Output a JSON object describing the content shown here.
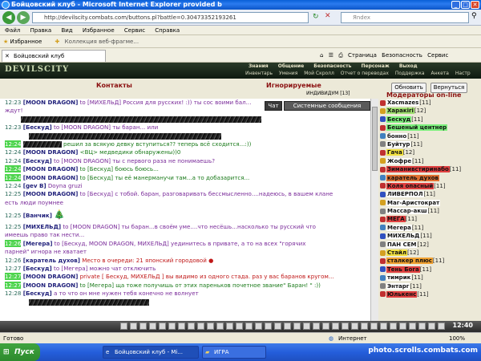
{
  "window": {
    "title": "Бойцовский клуб - Microsoft Internet Explorer provided b",
    "url": "http://devilscity.combats.com/buttons.pl?battle=0.30473352193261",
    "search_placeholder": "Яndex"
  },
  "menu": [
    "Файл",
    "Правка",
    "Вид",
    "Избранное",
    "Сервис",
    "Справка"
  ],
  "favorites": {
    "label": "Избранное",
    "link": "Коллекция веб-фрагме..."
  },
  "tab": {
    "label": "Бойцовский клуб"
  },
  "tools": [
    "Страница",
    "Безопасность",
    "Сервис"
  ],
  "game": {
    "logo": "DEVILSCITY",
    "topnav": [
      "Знания",
      "Общение",
      "Безопасность",
      "Персонаж",
      "Выход"
    ],
    "subnav": [
      "Инвентарь",
      "Умения",
      "Мой Скролл",
      "Отчет о переводах",
      "Поддержка",
      "Анкета",
      "Настр"
    ]
  },
  "panel": {
    "contacts": "Контакты",
    "ignored": "Игнорируемые",
    "moderators": "Модераторы on-line",
    "refresh": "Обновить",
    "back": "Вернуться",
    "individual": "ИНДИВИДУМ [13]"
  },
  "chattabs": {
    "chat": "Чат",
    "system": "Системные сообщения"
  },
  "chat": [
    {
      "time": "12:23",
      "nick": "[MOON DRAGON]",
      "text": " to [МИХЕЛЬД] Россия для русских! :)) ты сос воими бал..."
    },
    {
      "time": "",
      "nick": "",
      "text": "ждут!"
    },
    {
      "time": "12:23",
      "nick": "[Бескуд]",
      "text": " to [MOON DRAGON] ты баран... или"
    },
    {
      "time": "12:24",
      "nick": "",
      "text": " решил за всякую девку вступиться?? теперь всё сходится...:))"
    },
    {
      "time": "12:24",
      "nick": "[MOON DRAGON]",
      "text": " <ВЦ> медведики обнаружены))0"
    },
    {
      "time": "12:24",
      "nick": "[Бескуд]",
      "text": " to [MOON DRAGON] ты с первого раза не понимаешь?"
    },
    {
      "time": "12:24",
      "nick": "[MOON DRAGON]",
      "text": " to [Бескуд] боюсь боюсь..."
    },
    {
      "time": "12:24",
      "nick": "[MOON DRAGON]",
      "text": " to [Бескуд] ты её манерманучи там...а то добазарится..."
    },
    {
      "time": "12:24",
      "nick": "[gev B]",
      "text": " Doyna gruzi"
    },
    {
      "time": "12:25",
      "nick": "[MOON DRAGON]",
      "text": " to [Бескуд] с тобой. баран, разговаривать бессмысленно....надеюсь, в вашем клане"
    },
    {
      "time": "",
      "nick": "",
      "text": "есть люди поумнее"
    },
    {
      "time": "12:25",
      "nick": "[Ванчик]",
      "text": ""
    },
    {
      "time": "12:25",
      "nick": "[МИХЕЛЬД]",
      "text": " to [MOON DRAGON] ты баран...в своём уме....что несёшь...насколько ты русский что"
    },
    {
      "time": "",
      "nick": "",
      "text": "имеешь право так нести..."
    },
    {
      "time": "12:26",
      "nick": "[Мегера]",
      "text": " to [Бескуд, MOON DRAGON, МИХЕЛЬД] уединитесь в привате, а то на всех \"горячих"
    },
    {
      "time": "",
      "nick": "",
      "text": "парней\" игнора не хватает"
    },
    {
      "time": "12:26",
      "nick": "[каратель духов]",
      "text": " Место в очереди: 21 японский городовой"
    },
    {
      "time": "12:27",
      "nick": "[Бескуд]",
      "text": " to [Мегера] можно чат отключить"
    },
    {
      "time": "12:27",
      "nick": "[MOON DRAGON]",
      "text": " private [ Бескуд, МИХЕЛЬД ] вы видимо из одного стада. раз у вас баранов кругом..."
    },
    {
      "time": "12:27",
      "nick": "[MOON DRAGON]",
      "text": " to [Мегера] ща тоже получишь от этих пареньков почетное звание\" Баран! \" :))"
    },
    {
      "time": "12:28",
      "nick": "[Бескуд]",
      "text": " а то что он мне нужен тебя конечно не волнует"
    }
  ],
  "users": [
    {
      "name": "Xacmazes",
      "level": "[11]",
      "color": "#ffffff",
      "icon": "#c03030"
    },
    {
      "name": "Харакiri",
      "level": "[12]",
      "color": "#a0e070",
      "icon": "#d4a020"
    },
    {
      "name": "Бескуд",
      "level": "[11]",
      "color": "#7cf07c",
      "icon": "#3050c0"
    },
    {
      "name": "Бешеный центнер",
      "level": "",
      "color": "#7cf07c",
      "icon": "#c03030"
    },
    {
      "name": "бонно",
      "level": "[11]",
      "color": "#ffffff",
      "icon": "#4080c0"
    },
    {
      "name": "Буйтур",
      "level": "[11]",
      "color": "#ffffff",
      "icon": "#808080"
    },
    {
      "name": "Гача",
      "level": "[12]",
      "color": "#f0e040",
      "icon": "#c03030"
    },
    {
      "name": "Жофре",
      "level": "[11]",
      "color": "#ffffff",
      "icon": "#d4a020"
    },
    {
      "name": "Зиманивстиринабо",
      "level": "[11]",
      "color": "#e04040",
      "icon": "#c03030"
    },
    {
      "name": "каратель духов",
      "level": "",
      "color": "#e07030",
      "icon": "#4080c0"
    },
    {
      "name": "Коля опасный",
      "level": "[11]",
      "color": "#e04040",
      "icon": "#c03030"
    },
    {
      "name": "ЛИВЕРПОЛ",
      "level": "[11]",
      "color": "#ffffff",
      "icon": "#3050c0"
    },
    {
      "name": "Маг-Аристократ",
      "level": "",
      "color": "#ffffff",
      "icon": "#d4a020"
    },
    {
      "name": "Массар-акш",
      "level": "[11]",
      "color": "#ffffff",
      "icon": "#808080"
    },
    {
      "name": "МЕГА",
      "level": "[11]",
      "color": "#e04040",
      "icon": "#c03030"
    },
    {
      "name": "Мегера",
      "level": "[11]",
      "color": "#ffffff",
      "icon": "#4080c0"
    },
    {
      "name": "МИХЕЛЬД",
      "level": "[11]",
      "color": "#ffffff",
      "icon": "#3050c0"
    },
    {
      "name": "ПАН СЕМ",
      "level": "[12]",
      "color": "#ffffff",
      "icon": "#808080"
    },
    {
      "name": "Стайл",
      "level": "[12]",
      "color": "#f0e040",
      "icon": "#d4a020"
    },
    {
      "name": "сталкер плюс",
      "level": "[11]",
      "color": "#f0a030",
      "icon": "#c03030"
    },
    {
      "name": "Тень Бога",
      "level": "[11]",
      "color": "#e04040",
      "icon": "#3050c0"
    },
    {
      "name": "тимрик",
      "level": "[11]",
      "color": "#ffffff",
      "icon": "#4080c0"
    },
    {
      "name": "Энтарг",
      "level": "[11]",
      "color": "#ffffff",
      "icon": "#808080"
    },
    {
      "name": "Юлькенс",
      "level": "[11]",
      "color": "#e04040",
      "icon": "#c03030"
    }
  ],
  "clock": "12:40",
  "status": {
    "left": "Готово",
    "zone": "Интернет",
    "zoom": "100%"
  },
  "taskbar": {
    "start": "Пуск",
    "task1": "Бойцовский клуб - Mi...",
    "task2": "ИГРА",
    "watermark": "photo.scrolls.combats.com"
  },
  "colors": {
    "chat_time": "#2a6a5a",
    "nick": "#1f1f7a",
    "header_red": "#8b1010",
    "highlight_green": "#4cd44c"
  }
}
